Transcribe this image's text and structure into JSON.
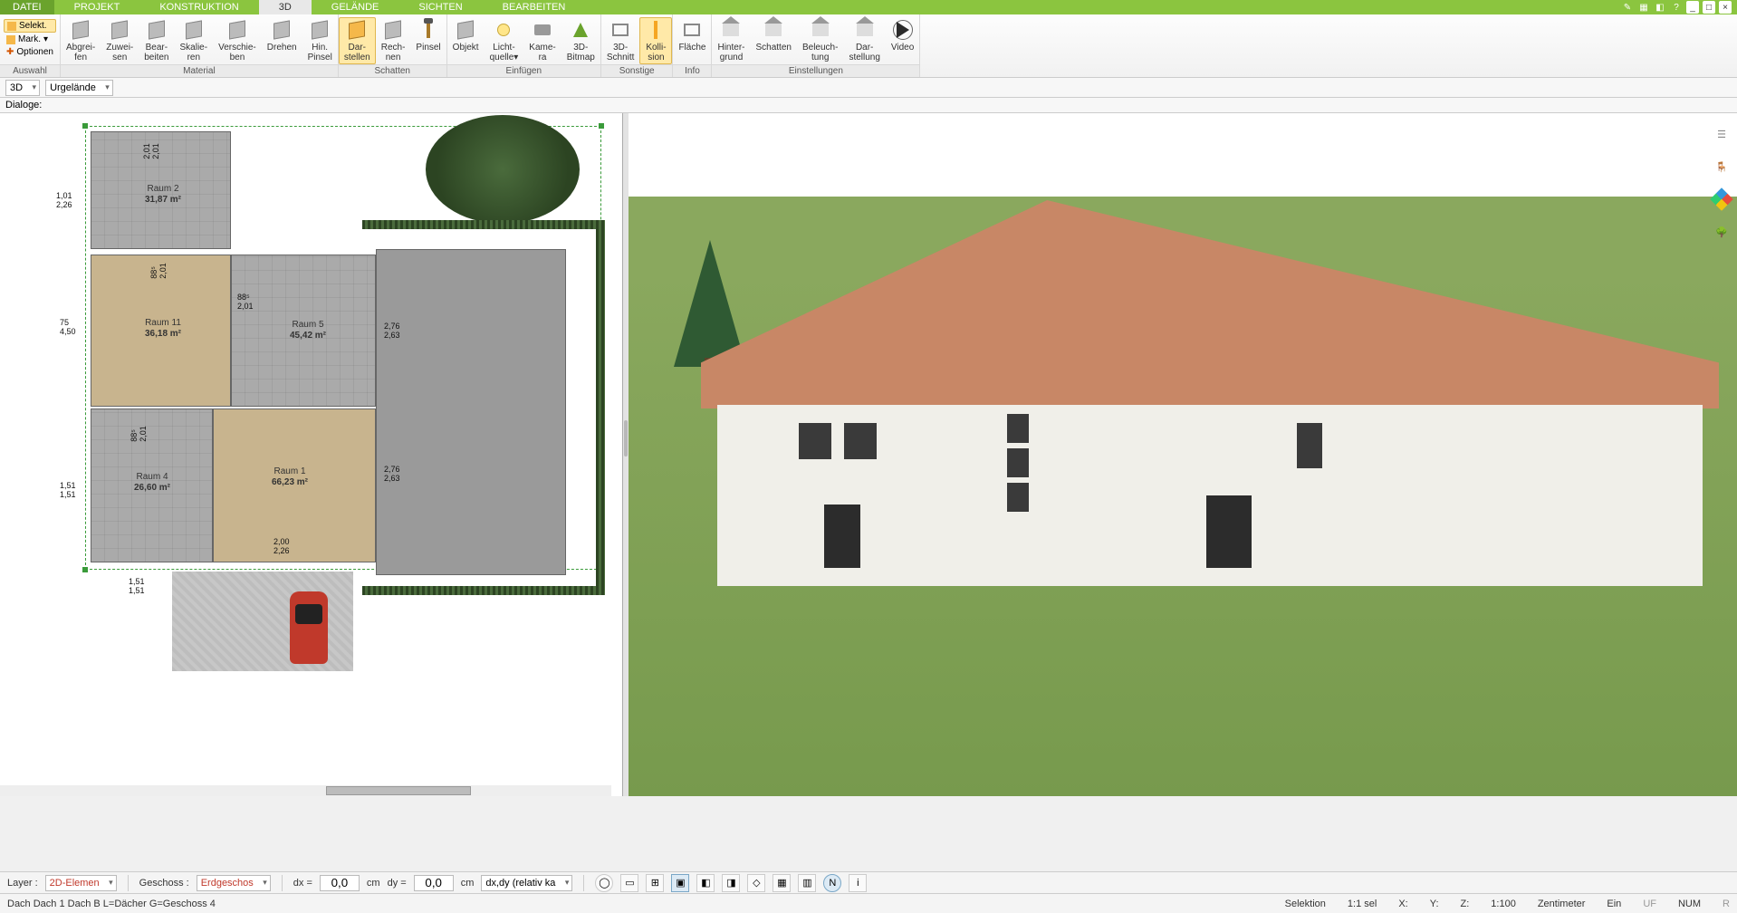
{
  "menu": {
    "tabs": [
      "DATEI",
      "PROJEKT",
      "KONSTRUKTION",
      "3D",
      "GELÄNDE",
      "SICHTEN",
      "BEARBEITEN"
    ],
    "active": 3
  },
  "ribbon": {
    "auswahl": {
      "label": "Auswahl",
      "selekt": "Selekt.",
      "mark": "Mark.",
      "optionen": "Optionen"
    },
    "material": {
      "label": "Material",
      "items": [
        "Abgrei-\nfen",
        "Zuwei-\nsen",
        "Bear-\nbeiten",
        "Skalie-\nren",
        "Verschie-\nben",
        "Drehen",
        "Hin.\nPinsel"
      ]
    },
    "schatten": {
      "label": "Schatten",
      "items": [
        "Dar-\nstellen",
        "Rech-\nnen",
        "Pinsel"
      ],
      "active": 0
    },
    "einfuegen": {
      "label": "Einfügen",
      "items": [
        "Objekt",
        "Licht-\nquelle▾",
        "Kame-\nra",
        "3D-\nBitmap"
      ]
    },
    "sonstige": {
      "label": "Sonstige",
      "items": [
        "3D-\nSchnitt",
        "Kolli-\nsion"
      ],
      "active": 1
    },
    "info": {
      "label": "Info",
      "items": [
        "Fläche"
      ]
    },
    "einstellungen": {
      "label": "Einstellungen",
      "items": [
        "Hinter-\ngrund",
        "Schatten",
        "Beleuch-\ntung",
        "Dar-\nstellung",
        "Video"
      ]
    }
  },
  "subbar": {
    "mode": "3D",
    "layer": "Urgelände"
  },
  "dialoge": "Dialoge:",
  "rooms": {
    "r2": {
      "name": "Raum 2",
      "area": "31,87 m²"
    },
    "r11": {
      "name": "Raum 11",
      "area": "36,18 m²"
    },
    "r5": {
      "name": "Raum 5",
      "area": "45,42 m²"
    },
    "r4": {
      "name": "Raum 4",
      "area": "26,60 m²"
    },
    "r1": {
      "name": "Raum 1",
      "area": "66,23 m²"
    }
  },
  "dims": {
    "d1a": "1,01",
    "d1b": "2,26",
    "d2a": "75",
    "d2b": "4,50",
    "d3a": "1,51",
    "d3b": "1,51",
    "d4a": "2,76",
    "d4b": "2,63",
    "d5a": "2,76",
    "d5b": "2,63",
    "d6a": "88⁵",
    "d6b": "2,01",
    "d7a": "88⁵",
    "d7b": "2,01",
    "d8a": "88⁵",
    "d8b": "2,01",
    "d9a": "2,01",
    "d9b": "2,01",
    "d10a": "2,00",
    "d10b": "2,26",
    "d11a": "1,51",
    "d11b": "1,51"
  },
  "bottom": {
    "layer_lbl": "Layer :",
    "layer_val": "2D-Elemen",
    "geschoss_lbl": "Geschoss :",
    "geschoss_val": "Erdgeschos",
    "dx_lbl": "dx =",
    "dx_val": "0,0",
    "dy_lbl": "dy =",
    "dy_val": "0,0",
    "unit": "cm",
    "mode": "dx,dy (relativ ka"
  },
  "status": {
    "left": "Dach Dach 1 Dach B L=Dächer G=Geschoss 4",
    "sel": "Selektion",
    "ratio": "1:1 sel",
    "x": "X:",
    "y": "Y:",
    "z": "Z:",
    "scale": "1:100",
    "unit": "Zentimeter",
    "ein": "Ein",
    "uf": "UF",
    "num": "NUM",
    "r": "R"
  }
}
